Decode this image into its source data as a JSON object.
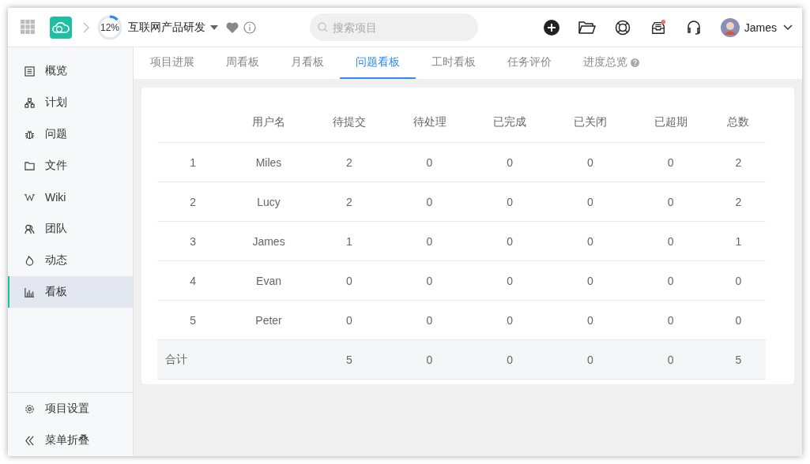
{
  "header": {
    "progress": {
      "label": "12%",
      "level": 0.12
    },
    "project": "互联网产品研发",
    "search": {
      "placeholder": "搜索项目"
    },
    "inbox_unread": true,
    "user": "James"
  },
  "sidebar": {
    "items": [
      {
        "label": "概览",
        "selected": false
      },
      {
        "label": "计划",
        "selected": false
      },
      {
        "label": "问题",
        "selected": false
      },
      {
        "label": "文件",
        "selected": false
      },
      {
        "label": "Wiki",
        "selected": false
      },
      {
        "label": "团队",
        "selected": false
      },
      {
        "label": "动态",
        "selected": false
      },
      {
        "label": "看板",
        "selected": true
      }
    ],
    "footer": [
      {
        "label": "项目设置"
      },
      {
        "label": "菜单折叠"
      }
    ]
  },
  "tabs": [
    {
      "label": "项目进展",
      "selected": false
    },
    {
      "label": "周看板",
      "selected": false
    },
    {
      "label": "月看板",
      "selected": false
    },
    {
      "label": "问题看板",
      "selected": true
    },
    {
      "label": "工时看板",
      "selected": false
    },
    {
      "label": "任务评价",
      "selected": false
    },
    {
      "label": "进度总览",
      "selected": false,
      "help": true
    }
  ],
  "table": {
    "columns": [
      "",
      "用户名",
      "待提交",
      "待处理",
      "已完成",
      "已关闭",
      "已超期",
      "总数"
    ],
    "rows": [
      [
        "1",
        "Miles",
        "2",
        "0",
        "0",
        "0",
        "0",
        "2"
      ],
      [
        "2",
        "Lucy",
        "2",
        "0",
        "0",
        "0",
        "0",
        "2"
      ],
      [
        "3",
        "James",
        "1",
        "0",
        "0",
        "0",
        "0",
        "1"
      ],
      [
        "4",
        "Evan",
        "0",
        "0",
        "0",
        "0",
        "0",
        "0"
      ],
      [
        "5",
        "Peter",
        "0",
        "0",
        "0",
        "0",
        "0",
        "0"
      ]
    ],
    "total": {
      "label": "合计",
      "values": [
        "5",
        "0",
        "0",
        "0",
        "0",
        "5"
      ]
    }
  }
}
